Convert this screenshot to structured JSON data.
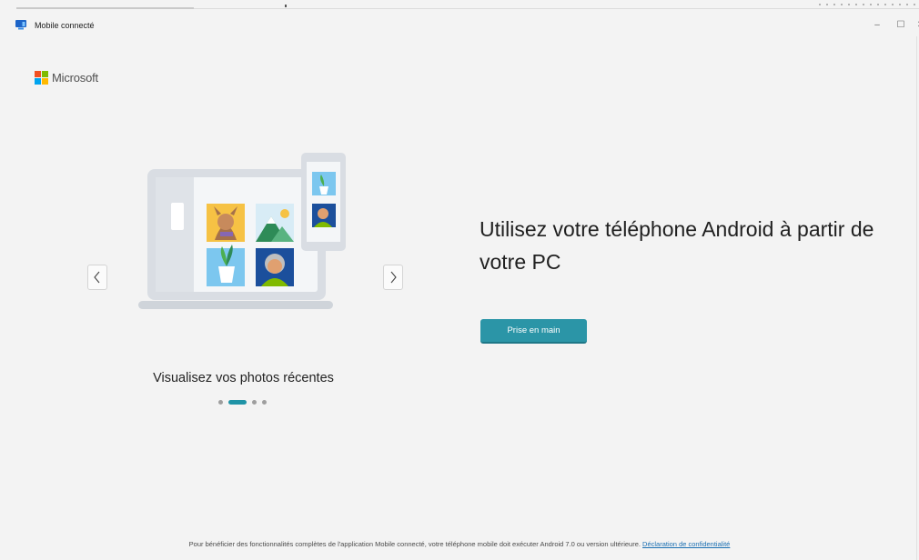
{
  "window": {
    "title": "Mobile connecté",
    "minimize_glyph": "–",
    "maximize_glyph": "☐",
    "close_glyph": "✕"
  },
  "brand": {
    "name": "Microsoft",
    "logo_colors": [
      "#f25022",
      "#7fba00",
      "#00a4ef",
      "#ffb900"
    ]
  },
  "carousel": {
    "caption": "Visualisez vos photos récentes",
    "prev_glyph": "‹",
    "next_glyph": "›",
    "total_slides": 4,
    "active_slide": 2,
    "accent_color": "#1f93a6"
  },
  "main": {
    "headline": "Utilisez votre téléphone Android à partir de votre PC",
    "cta_label": "Prise en main",
    "cta_color": "#2b95a7"
  },
  "footer": {
    "text": "Pour bénéficier des fonctionnalités complètes de l'application Mobile connecté, votre téléphone mobile doit exécuter Android 7.0 ou version ultérieure. ",
    "link_label": "Déclaration de confidentialité"
  }
}
